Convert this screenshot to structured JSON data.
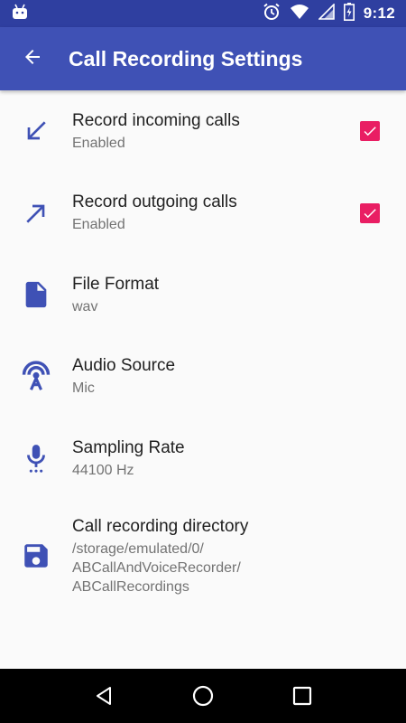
{
  "status_bar": {
    "time": "9:12",
    "icons": [
      "android-icon",
      "alarm-icon",
      "wifi-icon",
      "signal-icon",
      "battery-charging-icon"
    ]
  },
  "app_bar": {
    "title": "Call Recording Settings",
    "back_icon": "arrow-back-icon"
  },
  "settings": [
    {
      "icon": "call-received-icon",
      "title": "Record incoming calls",
      "summary": "Enabled",
      "checked": true
    },
    {
      "icon": "call-made-icon",
      "title": "Record outgoing calls",
      "summary": "Enabled",
      "checked": true
    },
    {
      "icon": "file-icon",
      "title": "File Format",
      "summary": "wav"
    },
    {
      "icon": "antenna-icon",
      "title": "Audio Source",
      "summary": "Mic"
    },
    {
      "icon": "microphone-icon",
      "title": "Sampling Rate",
      "summary": "44100 Hz"
    },
    {
      "icon": "save-icon",
      "title": "Call recording directory",
      "summary": "/storage/emulated/0/\nABCallAndVoiceRecorder/\nABCallRecordings"
    }
  ],
  "nav_bar": {
    "icons": [
      "back-triangle-icon",
      "home-circle-icon",
      "recents-square-icon"
    ]
  },
  "colors": {
    "primary": "#3f51b5",
    "primary_dark": "#2f3fa0",
    "accent": "#e91e63",
    "icon": "#3f51b5"
  }
}
